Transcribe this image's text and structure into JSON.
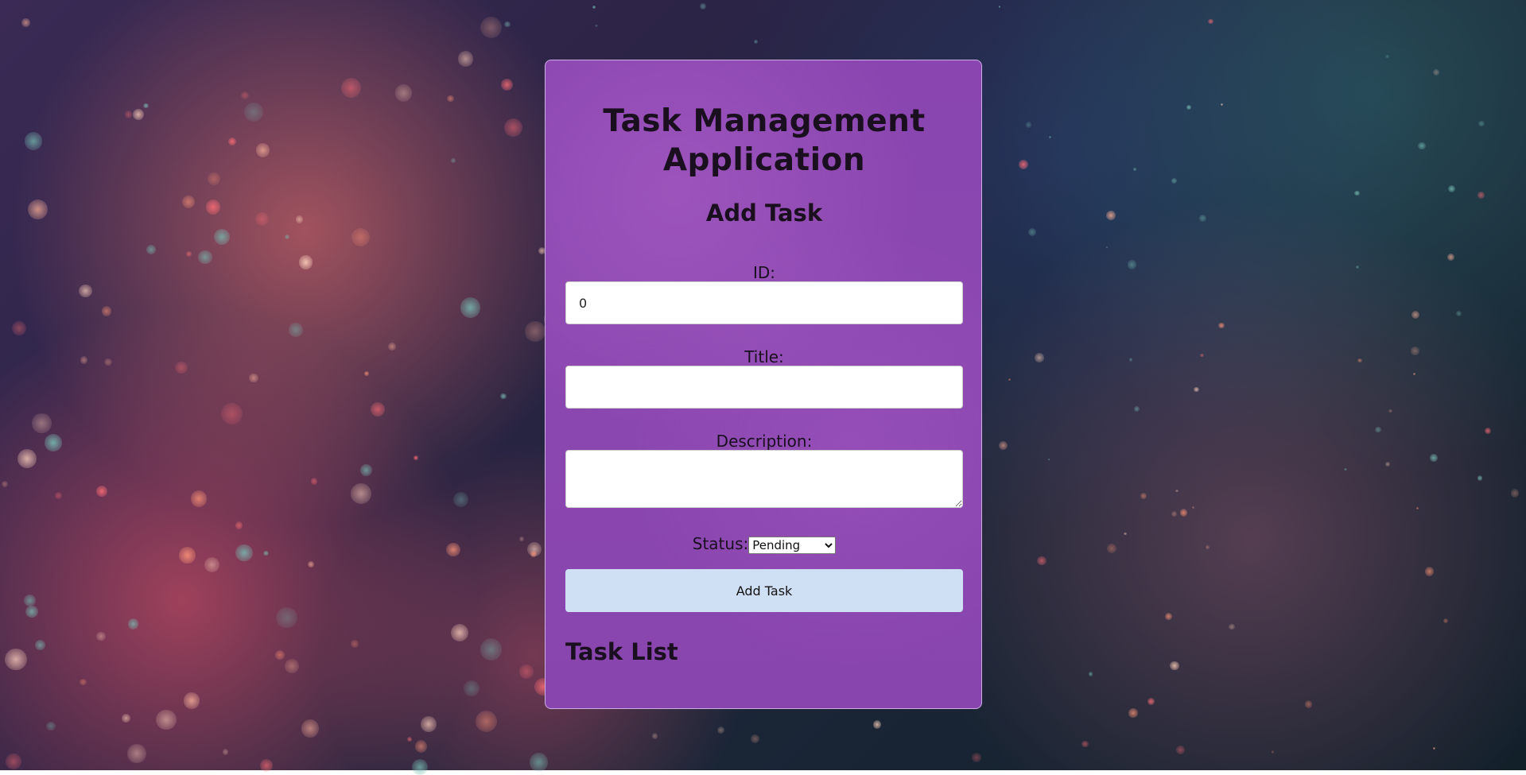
{
  "app": {
    "title": "Task Management Application"
  },
  "add_task": {
    "heading": "Add Task",
    "id_label": "ID:",
    "id_value": "0",
    "title_label": "Title:",
    "title_value": "",
    "description_label": "Description:",
    "description_value": "",
    "status_label": "Status:",
    "status_selected": "Pending",
    "submit_label": "Add Task"
  },
  "task_list": {
    "heading": "Task List"
  },
  "colors": {
    "card": "#8a45b0",
    "button": "#cfe0f5",
    "text": "#1a0f1e"
  }
}
